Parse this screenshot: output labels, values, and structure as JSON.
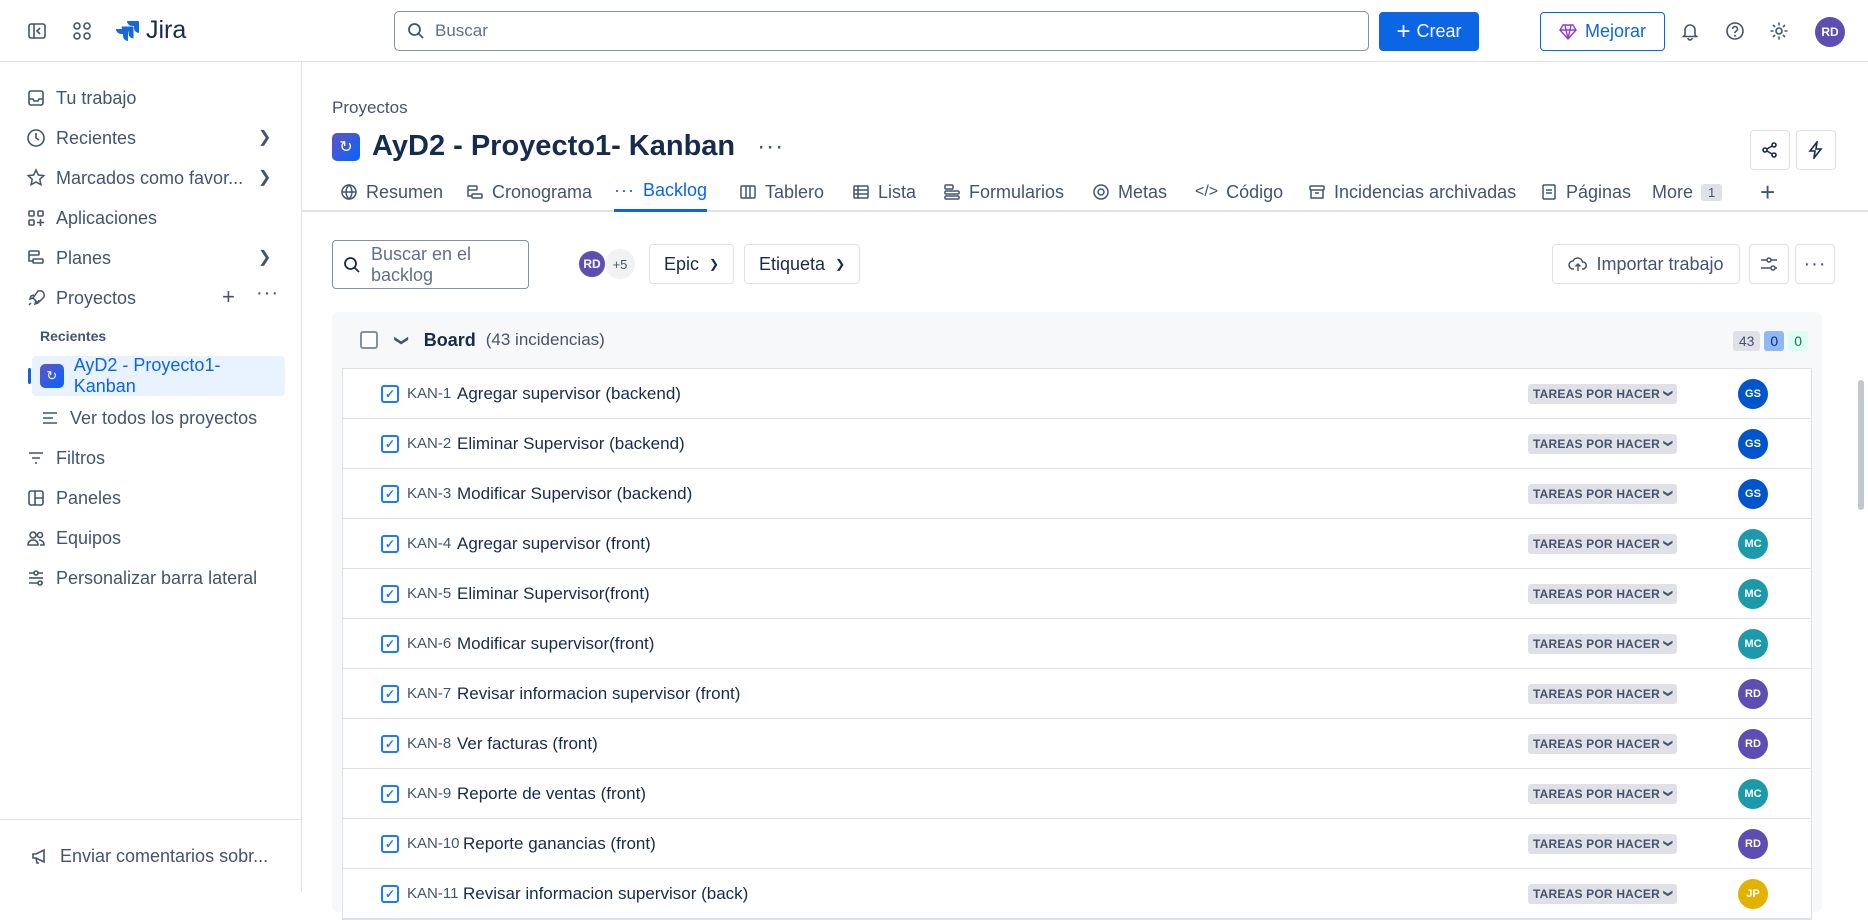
{
  "topbar": {
    "app_name": "Jira",
    "search_placeholder": "Buscar",
    "create_label": "Crear",
    "upgrade_label": "Mejorar",
    "user_initials": "RD",
    "user_color": "#5e4db2"
  },
  "sidebar": {
    "items": [
      {
        "label": "Tu trabajo",
        "icon": "inbox-icon"
      },
      {
        "label": "Recientes",
        "icon": "clock-icon"
      },
      {
        "label": "Marcados como favor...",
        "icon": "star-icon"
      },
      {
        "label": "Aplicaciones",
        "icon": "apps-icon"
      },
      {
        "label": "Planes",
        "icon": "plans-icon"
      },
      {
        "label": "Proyectos",
        "icon": "rocket-icon"
      }
    ],
    "recent_heading": "Recientes",
    "active_project": "AyD2 - Proyecto1- Kanban",
    "view_all": "Ver todos los proyectos",
    "more_items": [
      {
        "label": "Filtros",
        "icon": "filter-icon"
      },
      {
        "label": "Paneles",
        "icon": "dashboard-icon"
      },
      {
        "label": "Equipos",
        "icon": "people-icon"
      },
      {
        "label": "Personalizar barra lateral",
        "icon": "customize-icon"
      }
    ],
    "feedback": "Enviar comentarios sobr..."
  },
  "main": {
    "breadcrumb": "Proyectos",
    "title": "AyD2 - Proyecto1- Kanban",
    "tabs": [
      {
        "label": "Resumen",
        "icon": "globe-icon"
      },
      {
        "label": "Cronograma",
        "icon": "timeline-icon"
      },
      {
        "label": "Backlog",
        "icon": "dots-icon"
      },
      {
        "label": "Tablero",
        "icon": "board-icon"
      },
      {
        "label": "Lista",
        "icon": "list-icon"
      },
      {
        "label": "Formularios",
        "icon": "forms-icon"
      },
      {
        "label": "Metas",
        "icon": "target-icon"
      },
      {
        "label": "Código",
        "icon": "code-icon"
      },
      {
        "label": "Incidencias archivadas",
        "icon": "archive-icon"
      },
      {
        "label": "Páginas",
        "icon": "pages-icon"
      },
      {
        "label": "More",
        "icon": ""
      }
    ],
    "more_count": "1",
    "backlog_search_placeholder": "Buscar en el backlog",
    "filter_avatar": "RD",
    "filter_more": "+5",
    "epic_label": "Epic",
    "label_label": "Etiqueta",
    "import_label": "Importar trabajo"
  },
  "board": {
    "name": "Board",
    "count_text": "(43 incidencias)",
    "count_todo": "43",
    "count_progress": "0",
    "count_done": "0",
    "rows": [
      {
        "key": "KAN-1",
        "summary": "Agregar supervisor (backend)",
        "status": "TAREAS POR HACER",
        "assignee": "GS",
        "color": "#0055cc"
      },
      {
        "key": "KAN-2",
        "summary": "Eliminar Supervisor (backend)",
        "status": "TAREAS POR HACER",
        "assignee": "GS",
        "color": "#0055cc"
      },
      {
        "key": "KAN-3",
        "summary": "Modificar Supervisor (backend)",
        "status": "TAREAS POR HACER",
        "assignee": "GS",
        "color": "#0055cc"
      },
      {
        "key": "KAN-4",
        "summary": "Agregar supervisor (front)",
        "status": "TAREAS POR HACER",
        "assignee": "MC",
        "color": "#1d9aaa"
      },
      {
        "key": "KAN-5",
        "summary": "Eliminar Supervisor(front)",
        "status": "TAREAS POR HACER",
        "assignee": "MC",
        "color": "#1d9aaa"
      },
      {
        "key": "KAN-6",
        "summary": "Modificar supervisor(front)",
        "status": "TAREAS POR HACER",
        "assignee": "MC",
        "color": "#1d9aaa"
      },
      {
        "key": "KAN-7",
        "summary": "Revisar informacion supervisor (front)",
        "status": "TAREAS POR HACER",
        "assignee": "RD",
        "color": "#5e4db2"
      },
      {
        "key": "KAN-8",
        "summary": "Ver facturas (front)",
        "status": "TAREAS POR HACER",
        "assignee": "RD",
        "color": "#5e4db2"
      },
      {
        "key": "KAN-9",
        "summary": "Reporte de ventas (front)",
        "status": "TAREAS POR HACER",
        "assignee": "MC",
        "color": "#1d9aaa"
      },
      {
        "key": "KAN-10",
        "summary": "Reporte ganancias (front)",
        "status": "TAREAS POR HACER",
        "assignee": "RD",
        "color": "#5e4db2"
      },
      {
        "key": "KAN-11",
        "summary": "Revisar informacion supervisor (back)",
        "status": "TAREAS POR HACER",
        "assignee": "JP",
        "color": "#e2b203"
      }
    ]
  }
}
